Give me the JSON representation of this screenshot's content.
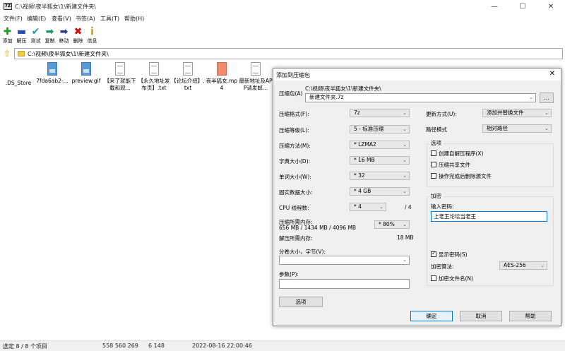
{
  "window": {
    "icon_text": "7Z",
    "title": "C:\\视频\\夜半狐女\\1\\新建文件夹\\",
    "minimize": "—",
    "maximize": "☐",
    "close": "✕"
  },
  "menu": [
    "文件(F)",
    "编辑(E)",
    "查看(V)",
    "书签(A)",
    "工具(T)",
    "帮助(H)"
  ],
  "toolbar": [
    {
      "label": "添加",
      "icon": "add-icon",
      "glyph": "✚",
      "color": "#1aa01a"
    },
    {
      "label": "解压",
      "icon": "extract-icon",
      "glyph": "▬",
      "color": "#2a4ab0"
    },
    {
      "label": "测试",
      "icon": "test-icon",
      "glyph": "✔",
      "color": "#1aa0a0"
    },
    {
      "label": "复制",
      "icon": "copy-icon",
      "glyph": "➡",
      "color": "#1a9a6a"
    },
    {
      "label": "移动",
      "icon": "move-icon",
      "glyph": "➡",
      "color": "#2a3a90"
    },
    {
      "label": "删除",
      "icon": "delete-icon",
      "glyph": "✖",
      "color": "#d01010"
    },
    {
      "label": "信息",
      "icon": "info-icon",
      "glyph": "i",
      "color": "#c8a000"
    }
  ],
  "address": {
    "path": "C:\\视频\\夜半狐女\\1\\新建文件夹\\"
  },
  "files": [
    {
      "name": ".DS_Store",
      "type": "none"
    },
    {
      "name": "7fda6ab2-...",
      "type": "img"
    },
    {
      "name": "preview.gif",
      "type": "img"
    },
    {
      "name": "【来了就能下载和观...",
      "type": "txt"
    },
    {
      "name": "【永久地址发布页】.txt",
      "type": "txt"
    },
    {
      "name": "【论坛介绍】.txt",
      "type": "txt"
    },
    {
      "name": "夜半狐女.mp4",
      "type": "mp4"
    },
    {
      "name": "最新地址及APP请发邮...",
      "type": "txt"
    }
  ],
  "status": {
    "selection": "选定 8 / 8 个项目",
    "size": "558 560 269",
    "packed": "6 148",
    "date": "2022-08-16 22:00:46"
  },
  "dialog": {
    "title": "添加到压缩包",
    "archive_label": "压缩包(A)",
    "archive_dir": "C:\\视频\\夜半狐女\\1\\新建文件夹\\",
    "archive_name": "新建文件夹.7z",
    "browse": "...",
    "format_label": "压缩格式(F):",
    "format_value": "7z",
    "level_label": "压缩等级(L):",
    "level_value": "5 - 标准压缩",
    "method_label": "压缩方法(M):",
    "method_value": "* LZMA2",
    "dict_label": "字典大小(D):",
    "dict_value": "* 16 MB",
    "word_label": "单词大小(W):",
    "word_value": "* 32",
    "solid_label": "固实数据大小:",
    "solid_value": "* 4 GB",
    "cpu_label": "CPU 线程数:",
    "cpu_value": "* 4",
    "cpu_total": "/ 4",
    "mem_comp_label": "压缩所需内存:",
    "mem_comp_value": "656 MB / 1434 MB / 4096 MB",
    "mem_percent": "* 80%",
    "mem_decomp_label": "解压所需内存:",
    "mem_decomp_value": "18 MB",
    "split_label": "分卷大小，字节(V):",
    "params_label": "参数(P):",
    "options_button": "选项",
    "update_label": "更新方式(U):",
    "update_value": "添加并替换文件",
    "pathmode_label": "路径模式",
    "pathmode_value": "相对路径",
    "options_group": "选项",
    "opt_sfx": "创建自解压程序(X)",
    "opt_shared": "压缩共享文件",
    "opt_delete": "操作完成后删除源文件",
    "enc_group": "加密",
    "password_label": "输入密码:",
    "password_value": "上老王论坛当老王",
    "show_password": "显示密码(S)",
    "enc_method_label": "加密算法:",
    "enc_method_value": "AES-256",
    "encrypt_names": "加密文件名(N)",
    "ok": "确定",
    "cancel": "取消",
    "help": "帮助"
  }
}
